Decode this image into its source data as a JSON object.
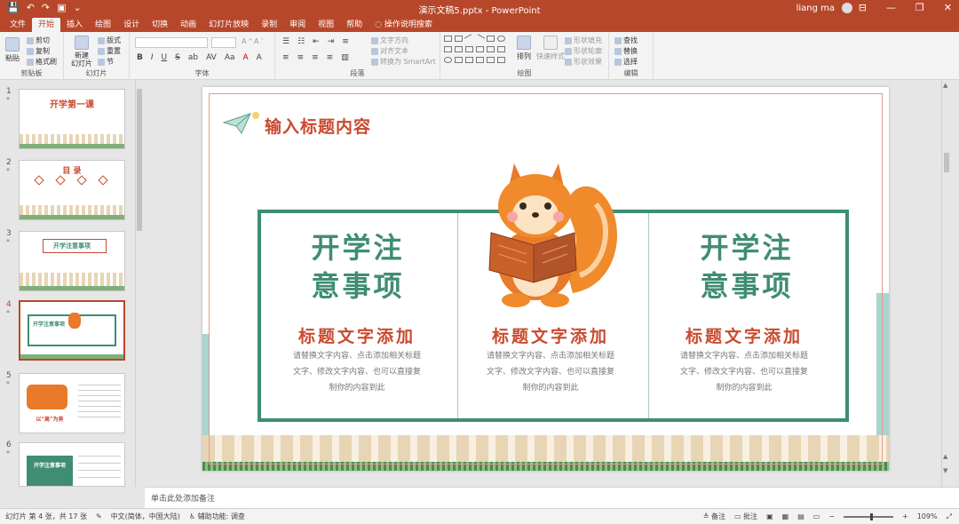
{
  "app": {
    "title": "演示文稿5.pptx  -  PowerPoint",
    "user": "liang ma",
    "accent": "#b7472a"
  },
  "qat": {
    "save": "💾",
    "undo": "↶",
    "redo": "↷",
    "present": "▣",
    "more": "⌄"
  },
  "window": {
    "ribbon_display": "⊟",
    "minimize": "—",
    "restore": "❐",
    "close": "✕"
  },
  "tabs": [
    "文件",
    "开始",
    "插入",
    "绘图",
    "设计",
    "切换",
    "动画",
    "幻灯片放映",
    "录制",
    "审阅",
    "视图",
    "帮助",
    "操作说明搜索"
  ],
  "ribbon": {
    "clipboard": {
      "paste": "粘贴",
      "cut": "剪切",
      "copy": "复制",
      "format_painter": "格式刷",
      "label": "剪贴板"
    },
    "slides": {
      "new_slide": "新建\n幻灯片",
      "layout": "版式",
      "reset": "重置",
      "section": "节",
      "label": "幻灯片"
    },
    "font": {
      "label": "字体",
      "buttons": [
        "B",
        "I",
        "U",
        "S",
        "ab",
        "AV",
        "Aa",
        "A",
        "A"
      ]
    },
    "paragraph": {
      "label": "段落",
      "text_direction": "文字方向",
      "align_text": "对齐文本",
      "smartart": "转换为 SmartArt"
    },
    "drawing": {
      "label": "绘图",
      "arrange": "排列",
      "quick_styles": "快速样式",
      "shape_fill": "形状填充",
      "shape_outline": "形状轮廓",
      "shape_effects": "形状效果"
    },
    "editing": {
      "label": "编辑",
      "find": "查找",
      "replace": "替换",
      "select": "选择"
    }
  },
  "thumbnails": [
    {
      "num": "1",
      "title": "开学第一课"
    },
    {
      "num": "2",
      "title": "目  录"
    },
    {
      "num": "3",
      "title": "开学注意事项"
    },
    {
      "num": "4",
      "title": "开学注意事项",
      "selected": true
    },
    {
      "num": "5",
      "title": "以“高”为美"
    },
    {
      "num": "6",
      "title": "开学注意事项"
    }
  ],
  "slide": {
    "heading": "输入标题内容",
    "columns": [
      {
        "title_line1": "开学注",
        "title_line2": "意事项",
        "subtitle": "标题文字添加",
        "body": [
          "请替换文字内容、点击添加相关标题",
          "文字、修改文字内容、也可以直接复",
          "制你的内容到此"
        ]
      },
      {
        "subtitle": "标题文字添加",
        "body": [
          "请替换文字内容、点击添加相关标题",
          "文字、修改文字内容、也可以直接复",
          "制你的内容到此"
        ]
      },
      {
        "title_line1": "开学注",
        "title_line2": "意事项",
        "subtitle": "标题文字添加",
        "body": [
          "请替换文字内容、点击添加相关标题",
          "文字、修改文字内容、也可以直接复",
          "制你的内容到此"
        ]
      }
    ]
  },
  "notes": {
    "placeholder": "单击此处添加备注"
  },
  "status": {
    "slide_info": "幻灯片 第 4 张，共 17 张",
    "language": "中文(简体，中国大陆)",
    "accessibility": "辅助功能: 调查",
    "notes_btn": "备注",
    "comments_btn": "批注",
    "zoom": "109%"
  }
}
